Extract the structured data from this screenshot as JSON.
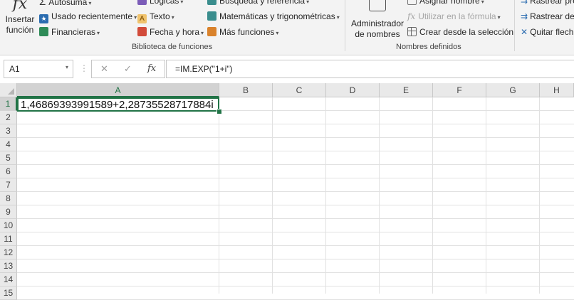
{
  "ribbon": {
    "insert_function": {
      "symbol": "fx",
      "label_line1": "Insertar",
      "label_line2": "función"
    },
    "library": {
      "autosum": "Autosuma",
      "recent": "Usado recientemente",
      "financial": "Financieras",
      "logical": "Lógicas",
      "text": "Texto",
      "datetime": "Fecha y hora",
      "lookup": "Búsqueda y referencia",
      "math": "Matemáticas y trigonométricas",
      "more": "Más funciones",
      "group_label": "Biblioteca de funciones"
    },
    "names": {
      "manager_line1": "Administrador",
      "manager_line2": "de nombres",
      "assign": "Asignar nombre",
      "use_in_formula": "Utilizar en la fórmula",
      "create_from_selection": "Crear desde la selección",
      "group_label": "Nombres definidos"
    },
    "audit": {
      "trace_precedents": "Rastrear pre",
      "trace_dependents": "Rastrear de",
      "remove_arrows": "Quitar flech"
    },
    "colors": {
      "icon_blue": "#2b6cb0",
      "icon_orange": "#d9822b",
      "icon_green": "#2e8b57",
      "icon_teal": "#3a8d8d"
    }
  },
  "formula_bar": {
    "name_box": "A1",
    "cancel": "✕",
    "enter": "✓",
    "fx": "fx",
    "formula": "=IM.EXP(\"1+i\")"
  },
  "grid": {
    "columns": [
      "A",
      "B",
      "C",
      "D",
      "E",
      "F",
      "G",
      "H"
    ],
    "rows": [
      "1",
      "2",
      "3",
      "4",
      "5",
      "6",
      "7",
      "8",
      "9",
      "10",
      "11",
      "12",
      "13",
      "14",
      "15"
    ],
    "cell_a1": "1,46869393991589+2,28735528717884i",
    "selection_color": "#217346"
  }
}
